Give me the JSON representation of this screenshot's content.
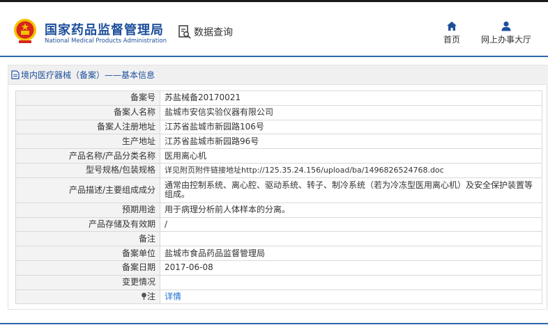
{
  "header": {
    "site_title_cn": "国家药品监督管理局",
    "site_title_en": "National Medical Products Administration",
    "data_query_label": "数据查询",
    "nav": {
      "home_label": "首页",
      "hall_label": "网上办事大厅"
    }
  },
  "panel": {
    "title": "境内医疗器械（备案）——基本信息"
  },
  "record": {
    "rows": [
      {
        "key": "备案号",
        "value": "苏盐械备20170021"
      },
      {
        "key": "备案人名称",
        "value": "盐城市安信实验仪器有限公司"
      },
      {
        "key": "备案人注册地址",
        "value": "江苏省盐城市新园路106号"
      },
      {
        "key": "生产地址",
        "value": "江苏省盐城市新园路96号"
      },
      {
        "key": "产品名称/产品分类名称",
        "value": "医用离心机"
      },
      {
        "key": "型号规格/包装规格",
        "value": "详见附页附件链接地址http://125.35.24.156/upload/ba/1496826524768.doc"
      },
      {
        "key": "产品描述/主要组成成分",
        "value": "通常由控制系统、离心腔、驱动系统、转子、制冷系统（若为冷冻型医用离心机）及安全保护装置等组成。"
      },
      {
        "key": "预期用途",
        "value": "用于病理分析前人体样本的分离。"
      },
      {
        "key": "产品存储及有效期",
        "value": "/"
      },
      {
        "key": "备注",
        "value": ""
      },
      {
        "key": "备案单位",
        "value": "盐城市食品药品监督管理局"
      },
      {
        "key": "备案日期",
        "value": "2017-06-08"
      },
      {
        "key": "变更情况",
        "value": ""
      },
      {
        "key": "注",
        "value": "详情"
      }
    ]
  },
  "colors": {
    "brand_blue": "#1d4f9a",
    "link_blue": "#1d6fd0",
    "rule_blue": "#2c66a9",
    "emblem_red": "#d7261e",
    "emblem_gold": "#f3c200"
  },
  "icons": [
    "national-emblem-icon",
    "data-query-icon",
    "home-icon",
    "user-icon",
    "document-icon",
    "note-pin-icon"
  ]
}
